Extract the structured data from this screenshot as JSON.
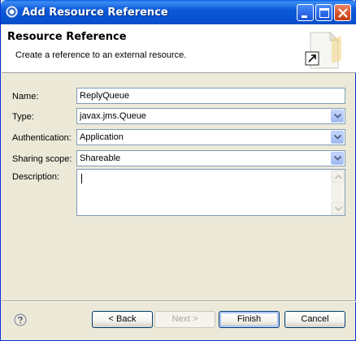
{
  "window": {
    "title": "Add Resource Reference"
  },
  "banner": {
    "title": "Resource Reference",
    "description": "Create a reference to an external resource."
  },
  "form": {
    "name": {
      "label": "Name:",
      "value": "ReplyQueue"
    },
    "type": {
      "label": "Type:",
      "value": "javax.jms.Queue"
    },
    "authentication": {
      "label": "Authentication:",
      "value": "Application"
    },
    "sharing_scope": {
      "label": "Sharing scope:",
      "value": "Shareable"
    },
    "description": {
      "label": "Description:",
      "value": ""
    }
  },
  "buttons": {
    "back": "< Back",
    "next": "Next >",
    "finish": "Finish",
    "cancel": "Cancel"
  },
  "icons": {
    "window": "app-icon",
    "banner": "resource-reference-wizard-icon",
    "help": "help-icon"
  },
  "colors": {
    "titlebar": "#0a5fe3",
    "dialog_background": "#ece9d8",
    "field_border": "#7f9db9"
  }
}
